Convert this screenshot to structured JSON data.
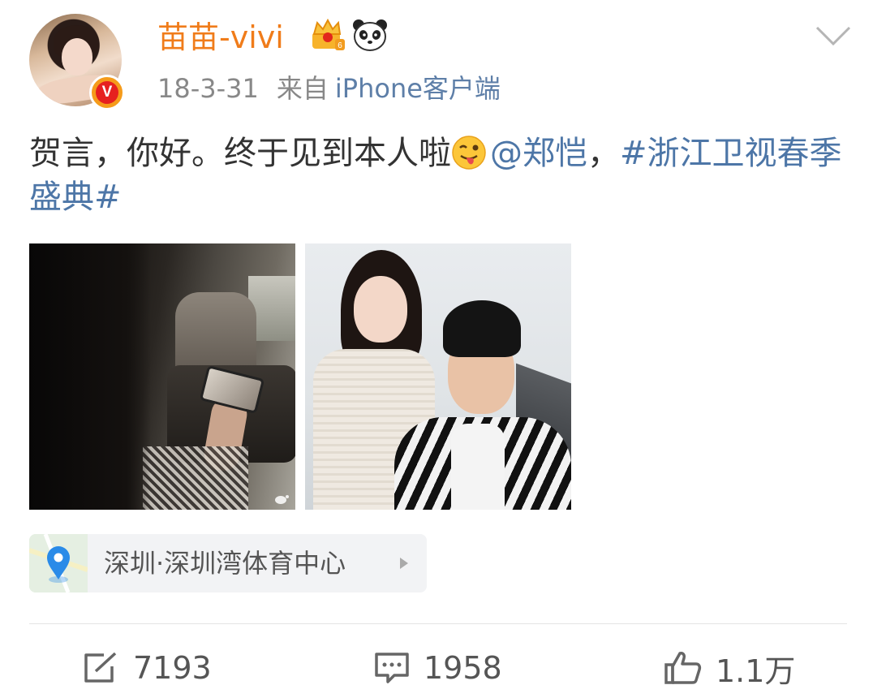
{
  "post": {
    "username": "苗苗-vivi",
    "time": "18-3-31",
    "via": "来自",
    "client": "iPhone客户端",
    "verified_badge": "V",
    "text_prefix": "贺言，你好。终于见到本人啦",
    "mention": "@郑恺",
    "separator": "，",
    "topic": "#浙江卫视春季盛典#",
    "icons": {
      "crown": "crown-member-icon",
      "panda": "panda-icon",
      "emoji": "tongue-wink-emoji-icon",
      "menu": "chevron-down-icon"
    }
  },
  "location": {
    "label": "深圳·深圳湾体育中心"
  },
  "actions": {
    "repost_count": "7193",
    "comment_count": "1958",
    "like_count": "1.1万"
  },
  "colors": {
    "username": "#f07c1a",
    "link": "#4d76a7",
    "meta": "#888888",
    "text": "#333333"
  }
}
